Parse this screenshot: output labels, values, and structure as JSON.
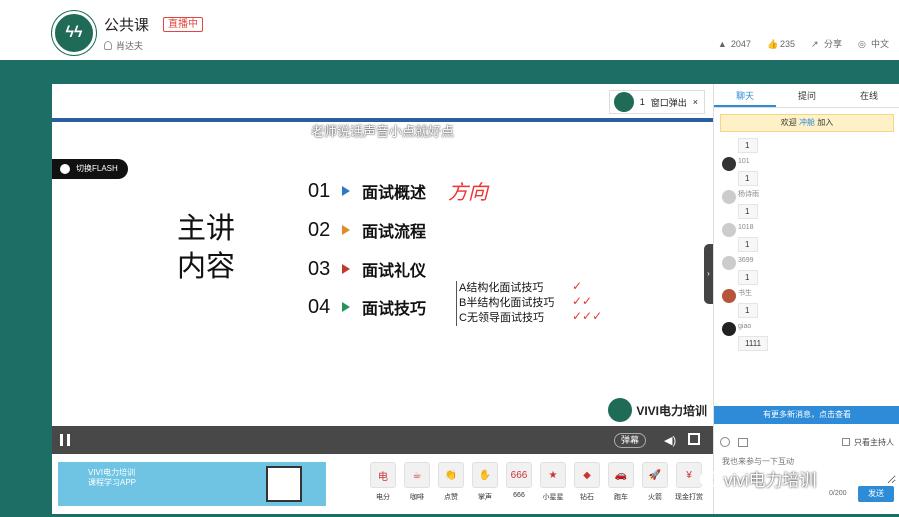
{
  "header": {
    "course_title": "公共课",
    "live_badge": "直播中",
    "teacher": "肖达夫",
    "likes": "2047",
    "thumbs": "235",
    "share": "分享",
    "language": "中文"
  },
  "video": {
    "brand_box_index": "1",
    "popout_label": "窗口弹出",
    "subtitle": "老师说话声音小点就好点",
    "flash_button": "切换FLASH",
    "slide_heading_line1": "主讲",
    "slide_heading_line2": "内容",
    "outline": [
      {
        "num": "01",
        "text": "面试概述",
        "color": "#2d79c7"
      },
      {
        "num": "02",
        "text": "面试流程",
        "color": "#e08a2b"
      },
      {
        "num": "03",
        "text": "面试礼仪",
        "color": "#c0392b"
      },
      {
        "num": "04",
        "text": "面试技巧",
        "color": "#27935b"
      }
    ],
    "handwrite": "方向",
    "sub_items": [
      "A结构化面试技巧",
      "B半结构化面试技巧",
      "C无领导面试技巧"
    ],
    "checks": [
      "✓",
      "✓✓",
      "✓✓✓"
    ],
    "watermark": "VIVI电力培训",
    "danmu": "弹幕"
  },
  "gifts": [
    {
      "icon": "电",
      "label": "电分"
    },
    {
      "icon": "☕",
      "label": "咖啡"
    },
    {
      "icon": "👏",
      "label": "点赞"
    },
    {
      "icon": "✋",
      "label": "掌声"
    },
    {
      "icon": "666",
      "label": "666"
    },
    {
      "icon": "★",
      "label": "小星星"
    },
    {
      "icon": "◆",
      "label": "钻石"
    },
    {
      "icon": "🚗",
      "label": "跑车"
    },
    {
      "icon": "🚀",
      "label": "火箭"
    },
    {
      "icon": "¥",
      "label": "现金打赏"
    }
  ],
  "ad": {
    "line1": "VIVI电力培训",
    "line2": "课程学习APP"
  },
  "chat": {
    "tabs": [
      "聊天",
      "提问",
      "在线"
    ],
    "welcome_prefix": "欢迎",
    "welcome_name": "冲舱",
    "welcome_suffix": "加入",
    "messages": [
      {
        "name": "",
        "text": "1"
      },
      {
        "name": "101",
        "text": "1"
      },
      {
        "name": "杨诗雨",
        "text": "1"
      },
      {
        "name": "1018",
        "text": "1"
      },
      {
        "name": "3699",
        "text": "1"
      },
      {
        "name": "书生",
        "text": "1"
      },
      {
        "name": "giao",
        "text": "1111"
      }
    ],
    "new_msg_notice": "有更多新消息，点击查看",
    "host_only": "只看主持人",
    "input_placeholder": "我也来参与一下互动",
    "counter": "0/200",
    "send": "发送"
  },
  "overlay": {
    "wechat_watermark": "vivi电力培训"
  }
}
